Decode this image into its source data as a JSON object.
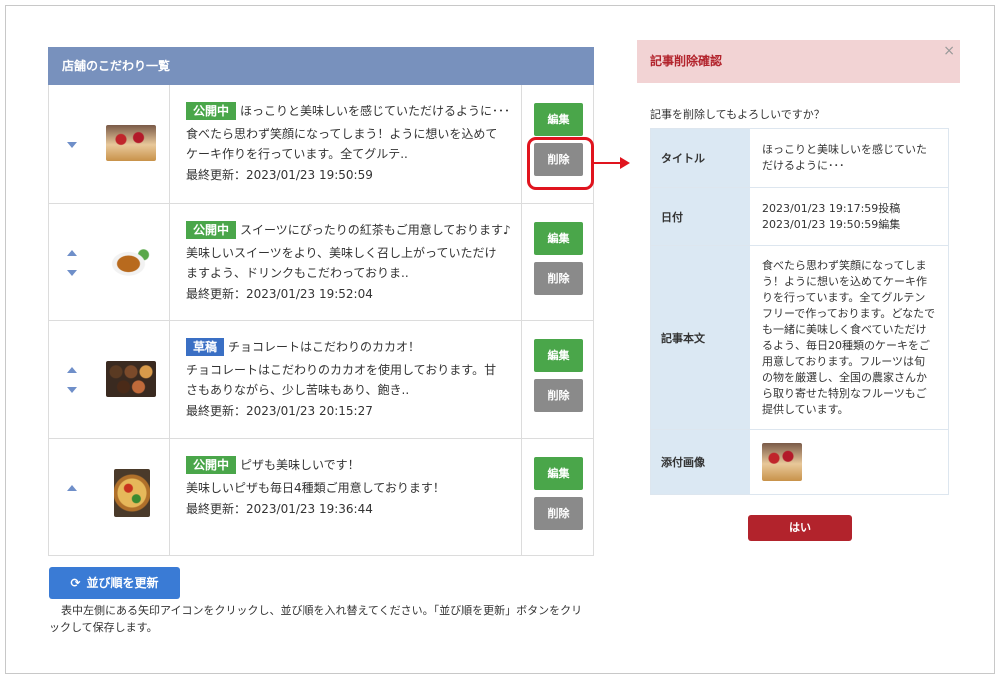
{
  "list": {
    "header": "店舗のこだわり一覧",
    "edit_label": "編集",
    "delete_label": "削除",
    "items": [
      {
        "status": "公開中",
        "title": "ほっこりと美味しいを感じていただけるように･･･",
        "excerpt": "食べたら思わず笑顔になってしまう！ように想いを込めてケーキ作りを行っています。全てグルテ..",
        "updated": "最終更新：2023/01/23 19:50:59",
        "image": "cake-image"
      },
      {
        "status": "公開中",
        "title": "スイーツにぴったりの紅茶もご用意しております♪",
        "excerpt": "美味しいスイーツをより、美味しく召し上がっていただけますよう、ドリンクもこだわっておりま..",
        "updated": "最終更新：2023/01/23 19:52:04",
        "image": "tea-image"
      },
      {
        "status": "草稿",
        "title": "チョコレートはこだわりのカカオ！",
        "excerpt": "チョコレートはこだわりのカカオを使用しております。甘さもありながら、少し苦味もあり、飽き..",
        "updated": "最終更新：2023/01/23 20:15:27",
        "image": "sweets-image"
      },
      {
        "status": "公開中",
        "title": "ピザも美味しいです！",
        "excerpt": "美味しいピザも毎日4種類ご用意しております！",
        "updated": "最終更新：2023/01/23 19:36:44",
        "image": "pizza-image"
      }
    ]
  },
  "sort_button": "並び順を更新",
  "help_text": "表中左側にある矢印アイコンをクリックし、並び順を入れ替えてください。「並び順を更新」ボタンをクリックして保存します。",
  "modal": {
    "title": "記事削除確認",
    "close": "×",
    "confirm": "記事を削除してもよろしいですか？",
    "rows": {
      "title_label": "タイトル",
      "title_value": "ほっこりと美味しいを感じていただけるように･･･",
      "date_label": "日付",
      "date_posted": "2023/01/23 19:17:59投稿",
      "date_edited": "2023/01/23 19:50:59編集",
      "body_label": "記事本文",
      "body_value": "食べたら思わず笑顔になってしまう！ように想いを込めてケーキ作りを行っています。全てグルテンフリーで作っております。どなたでも一緒に美味しく食べていただけるよう、毎日20種類のケーキをご用意しております。フルーツは旬の物を厳選し、全国の農家さんから取り寄せた特別なフルーツもご提供しています。",
      "image_label": "添付画像"
    },
    "yes_button": "はい"
  },
  "colors": {
    "header_bg": "#7891bd",
    "published": "#4aa64a",
    "draft": "#3a6fc4",
    "delete_gray": "#8a8a8a",
    "primary_blue": "#3a7bd5",
    "danger_red": "#b2232c",
    "highlight_red": "#e0141e"
  }
}
